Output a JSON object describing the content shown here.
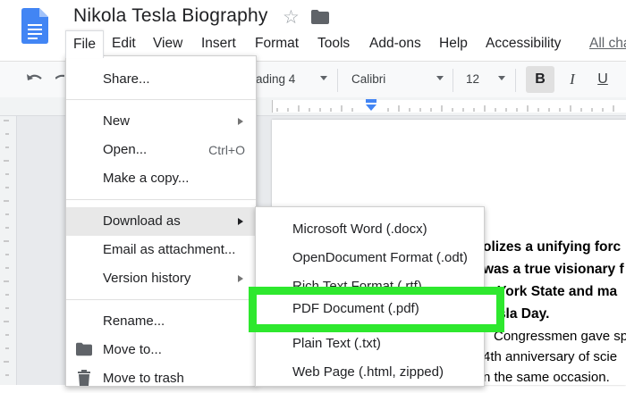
{
  "document": {
    "title": "Nikola Tesla Biography"
  },
  "menubar": {
    "items": [
      "File",
      "Edit",
      "View",
      "Insert",
      "Format",
      "Tools",
      "Add-ons",
      "Help",
      "Accessibility"
    ],
    "changes_link": "All cha"
  },
  "toolbar": {
    "style": "ading 4",
    "font": "Calibri",
    "size": "12",
    "bold": "B",
    "italic": "I",
    "underline": "U"
  },
  "file_menu": {
    "share": "Share...",
    "new": "New",
    "open": "Open...",
    "open_shortcut": "Ctrl+O",
    "make_copy": "Make a copy...",
    "download_as": "Download as",
    "email": "Email as attachment...",
    "version_history": "Version history",
    "rename": "Rename...",
    "move_to": "Move to...",
    "move_trash": "Move to trash"
  },
  "download_menu": {
    "items": [
      "Microsoft Word (.docx)",
      "OpenDocument Format (.odt)",
      "Rich Text Format (.rtf)",
      "PDF Document (.pdf)",
      "Plain Text (.txt)",
      "Web Page (.html, zipped)"
    ]
  },
  "page_text": {
    "line1": "olizes a unifying forc",
    "line2": "was a true visionary f",
    "line3": "w York State and ma",
    "line4": "Tesla Day.",
    "line5": "Congressmen gave sp",
    "line6": "4th anniversary of scie",
    "line7": "n the same occasion."
  },
  "colors": {
    "highlight": "#2ee82e",
    "docs_blue": "#4285f4"
  }
}
